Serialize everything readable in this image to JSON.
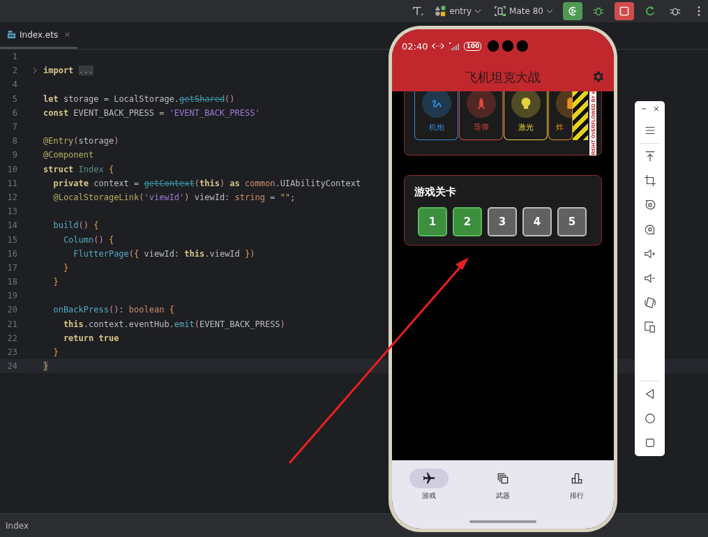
{
  "toolbar": {
    "module": "entry",
    "device": "Mate 80"
  },
  "editor": {
    "tab": {
      "label": "Index.ets",
      "selected": true
    },
    "lines": [
      {
        "num": "1",
        "current": false
      },
      {
        "num": "2",
        "current": false,
        "tokens": [
          {
            "text": "import ",
            "kind": "kw"
          },
          {
            "text": "...",
            "kind": "fold"
          }
        ]
      },
      {
        "num": "4",
        "current": false
      },
      {
        "num": "5",
        "current": false,
        "tokens": [
          {
            "text": "let",
            "kind": "kw"
          },
          {
            "text": " storage = LocalStorage.",
            "kind": "plain"
          },
          {
            "text": "getShared",
            "kind": "deprecated"
          },
          {
            "text": "()",
            "kind": "paren"
          }
        ]
      },
      {
        "num": "6",
        "current": false,
        "tokens": [
          {
            "text": "const",
            "kind": "kw"
          },
          {
            "text": " EVENT_BACK_PRESS = ",
            "kind": "plain"
          },
          {
            "text": "'EVENT_BACK_PRESS'",
            "kind": "str"
          }
        ]
      },
      {
        "num": "7",
        "current": false
      },
      {
        "num": "8",
        "current": false,
        "tokens": [
          {
            "text": "@Entry",
            "kind": "deco"
          },
          {
            "text": "(",
            "kind": "paren"
          },
          {
            "text": "storage",
            "kind": "plain"
          },
          {
            "text": ")",
            "kind": "paren"
          }
        ]
      },
      {
        "num": "9",
        "current": false,
        "tokens": [
          {
            "text": "@Component",
            "kind": "deco"
          }
        ]
      },
      {
        "num": "10",
        "current": false,
        "tokens": [
          {
            "text": "struct ",
            "kind": "kw"
          },
          {
            "text": "Index ",
            "kind": "type"
          },
          {
            "text": "{",
            "kind": "brace"
          }
        ]
      },
      {
        "num": "11",
        "current": false,
        "tokens": [
          {
            "text": "  private",
            "kind": "kw"
          },
          {
            "text": " context = ",
            "kind": "plain"
          },
          {
            "text": "getContext",
            "kind": "deprecated"
          },
          {
            "text": "(",
            "kind": "paren"
          },
          {
            "text": "this",
            "kind": "kw"
          },
          {
            "text": ")",
            "kind": "paren"
          },
          {
            "text": " as ",
            "kind": "kw"
          },
          {
            "text": "common",
            "kind": "type2"
          },
          {
            "text": ".UIAbilityContext",
            "kind": "plain"
          }
        ]
      },
      {
        "num": "12",
        "current": false,
        "tokens": [
          {
            "text": "  @LocalStorageLink",
            "kind": "deco"
          },
          {
            "text": "(",
            "kind": "paren"
          },
          {
            "text": "'viewId'",
            "kind": "str"
          },
          {
            "text": ")",
            "kind": "paren"
          },
          {
            "text": " viewId: ",
            "kind": "plain"
          },
          {
            "text": "string",
            "kind": "type2"
          },
          {
            "text": " = ",
            "kind": "plain"
          },
          {
            "text": "\"\"",
            "kind": "str2"
          },
          {
            "text": ";",
            "kind": "plain"
          }
        ]
      },
      {
        "num": "13",
        "current": false
      },
      {
        "num": "14",
        "current": false,
        "tokens": [
          {
            "text": "  build",
            "kind": "fn"
          },
          {
            "text": "() ",
            "kind": "paren"
          },
          {
            "text": "{",
            "kind": "brace"
          }
        ]
      },
      {
        "num": "15",
        "current": false,
        "tokens": [
          {
            "text": "    Column",
            "kind": "fn"
          },
          {
            "text": "() ",
            "kind": "paren"
          },
          {
            "text": "{",
            "kind": "brace"
          }
        ]
      },
      {
        "num": "16",
        "current": false,
        "tokens": [
          {
            "text": "      FlutterPage",
            "kind": "fn"
          },
          {
            "text": "(",
            "kind": "paren"
          },
          {
            "text": "{",
            "kind": "brace"
          },
          {
            "text": " viewId: ",
            "kind": "plain"
          },
          {
            "text": "this",
            "kind": "kw"
          },
          {
            "text": ".viewId ",
            "kind": "plain"
          },
          {
            "text": "}",
            "kind": "brace"
          },
          {
            "text": ")",
            "kind": "paren"
          }
        ]
      },
      {
        "num": "17",
        "current": false,
        "tokens": [
          {
            "text": "    }",
            "kind": "brace"
          }
        ]
      },
      {
        "num": "18",
        "current": false,
        "tokens": [
          {
            "text": "  }",
            "kind": "brace"
          }
        ]
      },
      {
        "num": "19",
        "current": false
      },
      {
        "num": "20",
        "current": false,
        "tokens": [
          {
            "text": "  onBackPress",
            "kind": "fn"
          },
          {
            "text": "()",
            "kind": "paren"
          },
          {
            "text": ": ",
            "kind": "plain"
          },
          {
            "text": "boolean ",
            "kind": "type2"
          },
          {
            "text": "{",
            "kind": "brace"
          }
        ]
      },
      {
        "num": "21",
        "current": false,
        "tokens": [
          {
            "text": "    this",
            "kind": "kw"
          },
          {
            "text": ".context.eventHub.",
            "kind": "plain"
          },
          {
            "text": "emit",
            "kind": "fn"
          },
          {
            "text": "(",
            "kind": "paren"
          },
          {
            "text": "EVENT_BACK_PRESS",
            "kind": "plain"
          },
          {
            "text": ")",
            "kind": "paren"
          }
        ]
      },
      {
        "num": "22",
        "current": false,
        "tokens": [
          {
            "text": "    return true",
            "kind": "kw"
          }
        ]
      },
      {
        "num": "23",
        "current": false,
        "tokens": [
          {
            "text": "  }",
            "kind": "brace"
          }
        ]
      },
      {
        "num": "24",
        "current": true,
        "tokens": [
          {
            "text": "}",
            "kind": "brace"
          }
        ]
      }
    ]
  },
  "status_bar": {
    "text": "Index"
  },
  "phone": {
    "time": "02:40",
    "battery": "100",
    "title": "飞机坦克大战",
    "weapons": [
      {
        "label": "机炮",
        "color": "#2f8ad8",
        "kind": "squiggle"
      },
      {
        "label": "导弹",
        "color": "#e0483a",
        "kind": "rocket"
      },
      {
        "label": "激光",
        "color": "#e3d23c",
        "kind": "bulb"
      },
      {
        "label": "炸",
        "color": "#e8901c",
        "kind": "battery"
      }
    ],
    "overflow_warning": "RIGHT OVERFLOWED BY 4",
    "levels": {
      "title": "游戏关卡",
      "items": [
        {
          "label": "1",
          "unlocked": true
        },
        {
          "label": "2",
          "unlocked": true
        },
        {
          "label": "3",
          "unlocked": false
        },
        {
          "label": "4",
          "unlocked": false
        },
        {
          "label": "5",
          "unlocked": false
        }
      ]
    },
    "nav": [
      {
        "label": "游戏",
        "kind": "plane",
        "selected": true
      },
      {
        "label": "武器",
        "kind": "copy",
        "selected": false
      },
      {
        "label": "排行",
        "kind": "chart",
        "selected": false
      }
    ]
  }
}
